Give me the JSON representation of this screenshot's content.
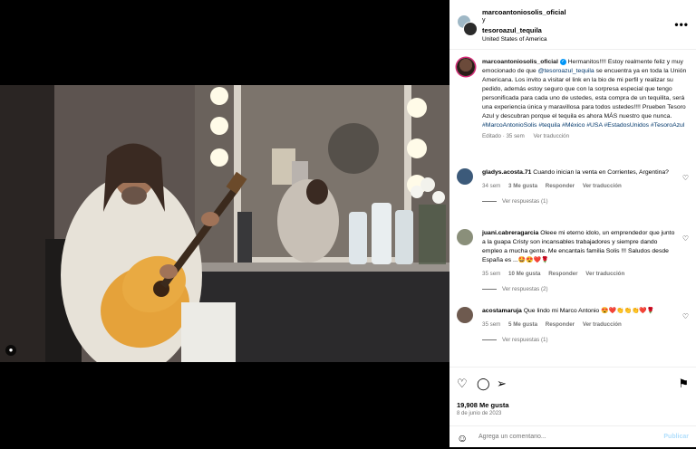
{
  "post": {
    "author": "marcoantoniosolis_oficial",
    "conj": "y",
    "collaborator": "tesoroazul_tequila",
    "location": "United States of America",
    "more": "•••"
  },
  "caption": {
    "username": "marcoantoniosolis_oficial",
    "text_a": "Hermanitos!!!! Estoy realmente feliz y muy emocionado de que",
    "mention": "@tesoroazul_tequila",
    "text_b": "se encuentra ya en toda la Unión Americana. Los invito a visitar el link en la bio de mi perfil y realizar su pedido, además estoy seguro que con la sorpresa especial que tengo personificada para cada uno de ustedes, esta compra de un tequilita, será una experiencia única y maravillosa para todos ustedes!!!! Prueben Tesoro Azul y descubran porque el tequila es ahora MÁS nuestro que nunca.",
    "hashtags": "#MarcoAntonioSolis #tequila #México #USA #EstadosUnidos #TesoroAzul",
    "edited": "Editado · 35 sem",
    "translate": "Ver traducción"
  },
  "comments": [
    {
      "user": "gladys.acosta.71",
      "text": "Cuando inician la venta en Corrientes, Argentina?",
      "time": "34 sem",
      "likes": "3 Me gusta",
      "reply": "Responder",
      "translate": "Ver traducción",
      "replies": "Ver respuestas (1)",
      "avatar_color": "#3c5a7a"
    },
    {
      "user": "juani.cabreragarcia",
      "text": "Oleee mi eterno idolo, un emprendedor que junto a la guapa Cristy son incansables trabajadores y siempre dando empleo a mucha gente. Me encantais familia Solis !!! Saludos desde España es ...🤩😍❤️🌹",
      "time": "35 sem",
      "likes": "10 Me gusta",
      "reply": "Responder",
      "translate": "Ver traducción",
      "replies": "Ver respuestas (2)",
      "avatar_color": "#8a8f7a"
    },
    {
      "user": "acostamaruja",
      "text": "Que lindo mi Marco Antonio 😍❤️👏👏👏❤️🌹",
      "time": "35 sem",
      "likes": "5 Me gusta",
      "reply": "Responder",
      "translate": "Ver traducción",
      "replies": "Ver respuestas (1)",
      "avatar_color": "#6e5a4f"
    }
  ],
  "actions": {
    "heart": "♡",
    "comment": "◯",
    "share": "➢",
    "save": "⚑"
  },
  "likes": "19,908 Me gusta",
  "date": "8 de junio de 2023",
  "comment_box": {
    "placeholder": "Agrega un comentario...",
    "publish": "Publicar",
    "smile": "☺"
  },
  "icons": {
    "tag": "person-tag-icon"
  },
  "colors": {
    "link": "#00376b",
    "verified": "#0095f6",
    "publish": "#b2dffc"
  }
}
